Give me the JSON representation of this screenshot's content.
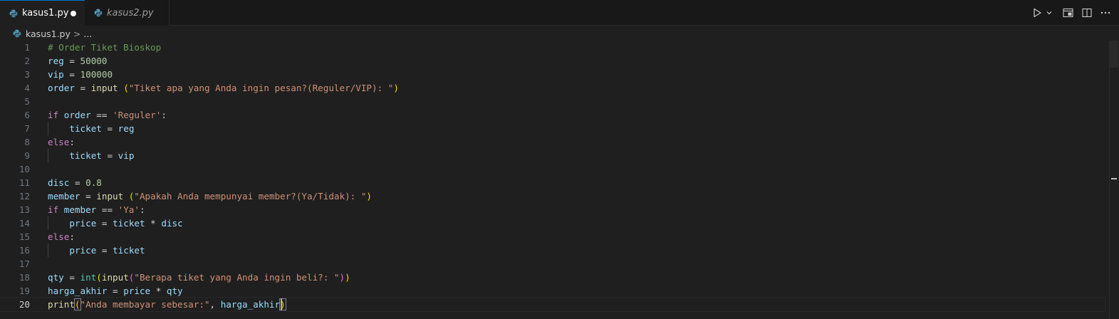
{
  "tabs": [
    {
      "label": "kasus1.py",
      "active": true,
      "modified": true,
      "icon": "python-file-icon"
    },
    {
      "label": "kasus2.py",
      "active": false,
      "modified": false,
      "icon": "python-file-icon"
    }
  ],
  "toolbar": {
    "icons": [
      "run-icon",
      "chevron-down-icon",
      "open-preview-icon",
      "split-editor-icon",
      "more-actions-icon"
    ]
  },
  "breadcrumb": {
    "file": "kasus1.py",
    "separator": ">",
    "rest": "..."
  },
  "editor": {
    "current_line": 20,
    "colors": {
      "background": "#1f1f1f",
      "comment": "#6a9955",
      "variable": "#9cdcfe",
      "number": "#b5cea8",
      "string": "#ce9178",
      "keyword": "#c586c0",
      "function": "#dcdcaa",
      "type": "#4ec9b0"
    },
    "lines": [
      {
        "n": "1",
        "text": "# Order Tiket Bioskop"
      },
      {
        "n": "2",
        "text": "reg = 50000"
      },
      {
        "n": "3",
        "text": "vip = 100000"
      },
      {
        "n": "4",
        "text": "order = input (\"Tiket apa yang Anda ingin pesan?(Reguler/VIP): \")"
      },
      {
        "n": "5",
        "text": ""
      },
      {
        "n": "6",
        "text": "if order == 'Reguler':"
      },
      {
        "n": "7",
        "text": "    ticket = reg"
      },
      {
        "n": "8",
        "text": "else:"
      },
      {
        "n": "9",
        "text": "    ticket = vip"
      },
      {
        "n": "10",
        "text": ""
      },
      {
        "n": "11",
        "text": "disc = 0.8"
      },
      {
        "n": "12",
        "text": "member = input (\"Apakah Anda mempunyai member?(Ya/Tidak): \")"
      },
      {
        "n": "13",
        "text": "if member == 'Ya':"
      },
      {
        "n": "14",
        "text": "    price = ticket * disc"
      },
      {
        "n": "15",
        "text": "else:"
      },
      {
        "n": "16",
        "text": "    price = ticket"
      },
      {
        "n": "17",
        "text": ""
      },
      {
        "n": "18",
        "text": "qty = int(input(\"Berapa tiket yang Anda ingin beli?: \"))"
      },
      {
        "n": "19",
        "text": "harga_akhir = price * qty"
      },
      {
        "n": "20",
        "text": "print(\"Anda membayar sebesar:\", harga_akhir)"
      }
    ]
  }
}
